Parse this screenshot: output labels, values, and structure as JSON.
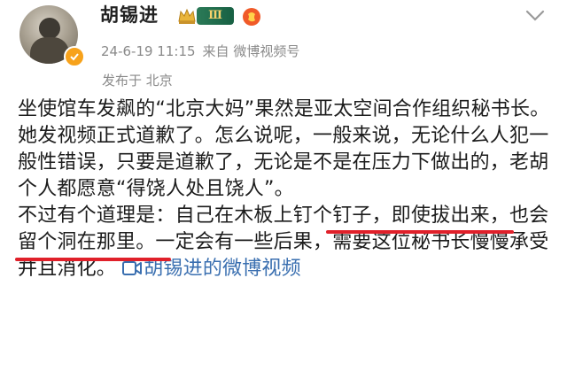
{
  "post": {
    "author": "胡锡进",
    "level_badge": "Ⅲ",
    "timestamp": "24-6-19 11:15",
    "source": "来自 微博视频号",
    "location": "发布于 北京",
    "paragraph1": "坐使馆车发飙的“北京大妈”果然是亚太空间合作组织秘书长。她发视频正式道歉了。怎么说呢，一般来说，无论什么人犯一般性错误，只要是道歉了，无论是不是在压力下做出的，老胡个人都愿意“得饶人处且饶人”。",
    "paragraph2": "不过有个道理是：自己在木板上钉个钉子，即使拔出来，也会留个洞在那里。一定会有一些后果，需要这位秘书长慢慢承受并且消化。",
    "video_link": "胡锡进的微博视频"
  },
  "colors": {
    "accent_link": "#3a6fb0",
    "underline": "#e0202a",
    "meta_text": "#8a8a8a",
    "level_badge_bg": "#176043",
    "verify_badge": "#f7a21b"
  },
  "icons": {
    "avatar": "avatar",
    "verify": "verified-badge-icon",
    "crown": "crown-icon",
    "fan": "fan-badge-icon",
    "more": "chevron-down-icon",
    "video": "video-icon"
  }
}
